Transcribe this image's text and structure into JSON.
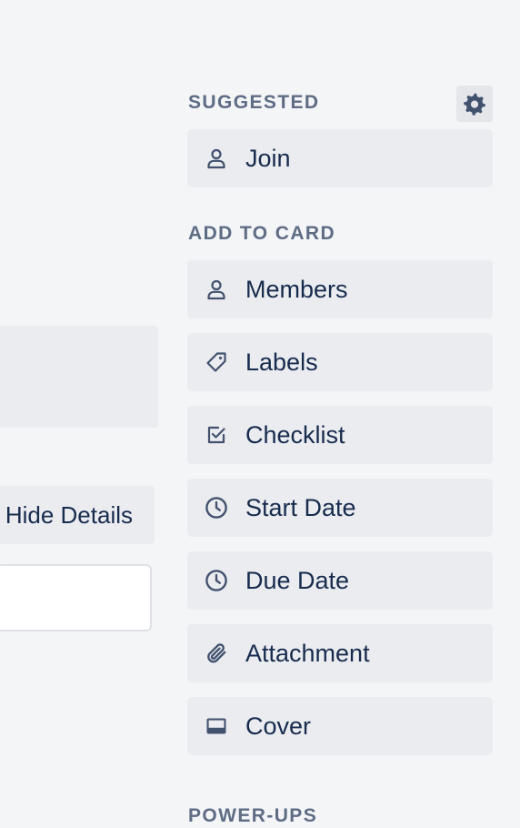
{
  "main": {
    "hide_details_label": "Hide Details",
    "comment_placeholder": ""
  },
  "sidebar": {
    "suggested": {
      "heading": "SUGGESTED",
      "items": [
        {
          "label": "Join",
          "icon": "person-icon"
        }
      ]
    },
    "add_to_card": {
      "heading": "ADD TO CARD",
      "items": [
        {
          "label": "Members",
          "icon": "person-icon"
        },
        {
          "label": "Labels",
          "icon": "tag-icon"
        },
        {
          "label": "Checklist",
          "icon": "checkbox-icon"
        },
        {
          "label": "Start Date",
          "icon": "clock-icon"
        },
        {
          "label": "Due Date",
          "icon": "clock-icon"
        },
        {
          "label": "Attachment",
          "icon": "paperclip-icon"
        },
        {
          "label": "Cover",
          "icon": "cover-icon"
        }
      ]
    },
    "power_ups": {
      "heading": "POWER-UPS"
    }
  },
  "colors": {
    "background": "#f4f5f7",
    "button_bg": "#ebecf0",
    "text": "#172b4d",
    "heading": "#5e6c84",
    "icon": "#42526e"
  }
}
